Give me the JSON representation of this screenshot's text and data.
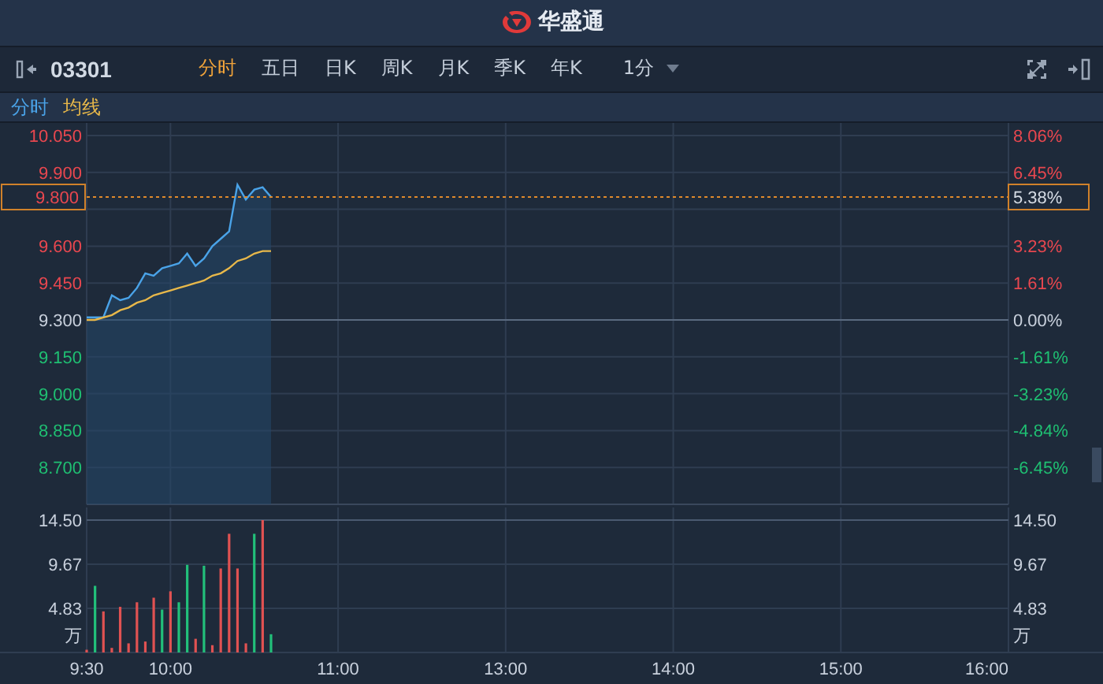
{
  "header": {
    "logo_text": "华盛通"
  },
  "toolbar": {
    "code": "03301",
    "tabs": [
      {
        "label": "分时",
        "selected": true
      },
      {
        "label": "五日",
        "selected": false
      },
      {
        "label": "日K",
        "selected": false
      },
      {
        "label": "周K",
        "selected": false
      },
      {
        "label": "月K",
        "selected": false
      },
      {
        "label": "季K",
        "selected": false
      },
      {
        "label": "年K",
        "selected": false
      }
    ],
    "interval": "1分"
  },
  "price_panel": {
    "chart_data": {
      "type": "line",
      "categories": [
        null,
        null,
        null,
        null,
        null,
        null,
        null,
        null,
        null,
        null,
        null,
        null,
        null,
        null,
        null,
        null,
        null,
        null,
        null,
        null,
        null,
        null,
        null,
        null,
        null,
        null,
        null,
        null,
        null,
        null,
        null,
        null,
        null,
        null,
        null,
        null,
        null,
        null,
        null,
        null,
        null,
        null,
        null,
        null,
        null,
        null,
        null,
        null,
        null,
        null,
        null,
        null,
        null,
        null,
        null,
        null,
        null,
        null,
        null,
        null,
        null,
        null,
        null,
        null,
        null,
        null,
        null,
        null,
        null,
        null,
        null,
        null,
        null,
        null,
        null,
        null,
        null,
        null,
        null,
        null,
        null,
        null,
        null,
        null,
        null,
        null,
        null,
        null,
        null,
        null,
        null,
        null,
        null,
        null,
        null,
        null,
        null,
        null,
        null,
        null,
        null,
        null,
        null,
        null,
        null,
        null,
        null,
        null,
        null,
        null,
        null
      ],
      "series": [
        {
          "name": "分时",
          "color": "#4aa3e8",
          "values": [
            9.31,
            9.31,
            9.31,
            9.4,
            9.38,
            9.39,
            9.43,
            9.49,
            9.48,
            9.51,
            9.52,
            9.53,
            9.57,
            9.52,
            9.55,
            9.6,
            9.63,
            9.66,
            9.85,
            9.79,
            9.83,
            9.84,
            9.8,
            null,
            null,
            null,
            null,
            null,
            null,
            null,
            null,
            null,
            null,
            null,
            null,
            null,
            null,
            null,
            null,
            null,
            null,
            null,
            null,
            null,
            null,
            null,
            null,
            null,
            null,
            null,
            null,
            null,
            null,
            null,
            null,
            null,
            null,
            null,
            null,
            null,
            null,
            null,
            null,
            null,
            null,
            null,
            null,
            null,
            null,
            null,
            null,
            null,
            null,
            null,
            null,
            null,
            null,
            null,
            null,
            null,
            null,
            null,
            null,
            null,
            null,
            null,
            null,
            null,
            null,
            null,
            null,
            null,
            null,
            null,
            null,
            null,
            null,
            null,
            null,
            null,
            null,
            null,
            null,
            null,
            null,
            null,
            null,
            null,
            null,
            null,
            null
          ]
        },
        {
          "name": "均线",
          "color": "#e8b84a",
          "values": [
            9.3,
            9.3,
            9.31,
            9.32,
            9.34,
            9.35,
            9.37,
            9.38,
            9.4,
            9.41,
            9.42,
            9.43,
            9.44,
            9.45,
            9.46,
            9.48,
            9.49,
            9.51,
            9.54,
            9.55,
            9.57,
            9.58,
            9.58,
            null,
            null,
            null,
            null,
            null,
            null,
            null,
            null,
            null,
            null,
            null,
            null,
            null,
            null,
            null,
            null,
            null,
            null,
            null,
            null,
            null,
            null,
            null,
            null,
            null,
            null,
            null,
            null,
            null,
            null,
            null,
            null,
            null,
            null,
            null,
            null,
            null,
            null,
            null,
            null,
            null,
            null,
            null,
            null,
            null,
            null,
            null,
            null,
            null,
            null,
            null,
            null,
            null,
            null,
            null,
            null,
            null,
            null,
            null,
            null,
            null,
            null,
            null,
            null,
            null,
            null,
            null,
            null,
            null,
            null,
            null,
            null,
            null,
            null,
            null,
            null,
            null,
            null,
            null,
            null,
            null,
            null,
            null,
            null,
            null,
            null,
            null,
            null
          ]
        }
      ],
      "ylim": [
        8.55,
        10.05
      ],
      "yticks": [
        {
          "value": 10.05,
          "label": "10.050"
        },
        {
          "value": 9.9,
          "label": "9.900"
        },
        {
          "value": 9.6,
          "label": "9.600"
        },
        {
          "value": 9.45,
          "label": "9.450"
        },
        {
          "value": 9.3,
          "label": "9.300"
        },
        {
          "value": 9.15,
          "label": "9.150"
        },
        {
          "value": 9.0,
          "label": "9.000"
        },
        {
          "value": 8.85,
          "label": "8.850"
        },
        {
          "value": 8.7,
          "label": "8.700"
        }
      ],
      "grid": true,
      "ref_lines": [
        {
          "axis": "y",
          "value": 9.3
        },
        {
          "axis": "y",
          "value": 9.8,
          "label": "9.800"
        }
      ]
    },
    "current": {
      "change": "5.38%"
    },
    "right_ticks": [
      "8.06%",
      "6.45%",
      "3.23%",
      "1.61%",
      "0.00%",
      "-1.61%",
      "-3.23%",
      "-4.84%",
      "-6.45%"
    ]
  },
  "volume_panel": {
    "chart_data": {
      "type": "bar",
      "categories": [
        "9:30",
        null,
        null,
        null,
        null,
        null,
        null,
        null,
        null,
        null,
        "10:00",
        null,
        null,
        null,
        null,
        null,
        null,
        null,
        null,
        null,
        null,
        null,
        null,
        null,
        null,
        null,
        null,
        null,
        null,
        null,
        "11:00",
        null,
        null,
        null,
        null,
        null,
        null,
        null,
        null,
        null,
        null,
        null,
        null,
        null,
        null,
        null,
        null,
        null,
        null,
        null,
        "13:00",
        null,
        null,
        null,
        null,
        null,
        null,
        null,
        null,
        null,
        null,
        null,
        null,
        null,
        null,
        null,
        null,
        null,
        null,
        null,
        "14:00",
        null,
        null,
        null,
        null,
        null,
        null,
        null,
        null,
        null,
        null,
        null,
        null,
        null,
        null,
        null,
        null,
        null,
        null,
        null,
        "15:00",
        null,
        null,
        null,
        null,
        null,
        null,
        null,
        null,
        null,
        null,
        null,
        null,
        null,
        null,
        null,
        null,
        null,
        null,
        null,
        "16:00"
      ],
      "series": [
        {
          "color": "#e05252",
          "values": [
            0.3,
            null,
            4.5,
            0.5,
            5,
            1,
            5.5,
            1.2,
            6,
            null,
            6.7,
            null,
            null,
            1.5,
            null,
            0.8,
            9.2,
            13,
            9.2,
            1,
            null,
            14.5,
            null,
            null,
            null,
            null,
            null,
            null,
            null,
            null,
            null,
            null,
            null,
            null,
            null,
            null,
            null,
            null,
            null,
            null,
            null,
            null,
            null,
            null,
            null,
            null,
            null,
            null,
            null,
            null,
            null,
            null,
            null,
            null,
            null,
            null,
            null,
            null,
            null,
            null,
            null,
            null,
            null,
            null,
            null,
            null,
            null,
            null,
            null,
            null,
            null,
            null,
            null,
            null,
            null,
            null,
            null,
            null,
            null,
            null,
            null,
            null,
            null,
            null,
            null,
            null,
            null,
            null,
            null,
            null,
            null,
            null,
            null,
            null,
            null,
            null,
            null,
            null,
            null,
            null,
            null,
            null,
            null,
            null,
            null,
            null,
            null,
            null,
            null,
            null,
            null
          ]
        },
        {
          "color": "#22c07a",
          "values": [
            null,
            7.3,
            null,
            null,
            null,
            null,
            null,
            null,
            null,
            4.7,
            null,
            5.5,
            9.6,
            null,
            9.5,
            null,
            null,
            null,
            null,
            null,
            13,
            null,
            2,
            null,
            null,
            null,
            null,
            null,
            null,
            null,
            null,
            null,
            null,
            null,
            null,
            null,
            null,
            null,
            null,
            null,
            null,
            null,
            null,
            null,
            null,
            null,
            null,
            null,
            null,
            null,
            null,
            null,
            null,
            null,
            null,
            null,
            null,
            null,
            null,
            null,
            null,
            null,
            null,
            null,
            null,
            null,
            null,
            null,
            null,
            null,
            null,
            null,
            null,
            null,
            null,
            null,
            null,
            null,
            null,
            null,
            null,
            null,
            null,
            null,
            null,
            null,
            null,
            null,
            null,
            null,
            null,
            null,
            null,
            null,
            null,
            null,
            null,
            null,
            null,
            null,
            null,
            null,
            null,
            null,
            null,
            null,
            null,
            null,
            null,
            null,
            null
          ]
        }
      ],
      "ylim": [
        0,
        14.5
      ],
      "ylabel": "万",
      "yticks": [
        {
          "value": 14.5,
          "label": "14.50"
        },
        {
          "value": 9.67,
          "label": "9.67"
        },
        {
          "value": 4.83,
          "label": "4.83"
        }
      ]
    },
    "right_ticks": [
      "14.50",
      "9.67",
      "4.83"
    ],
    "right_unit": "万"
  }
}
